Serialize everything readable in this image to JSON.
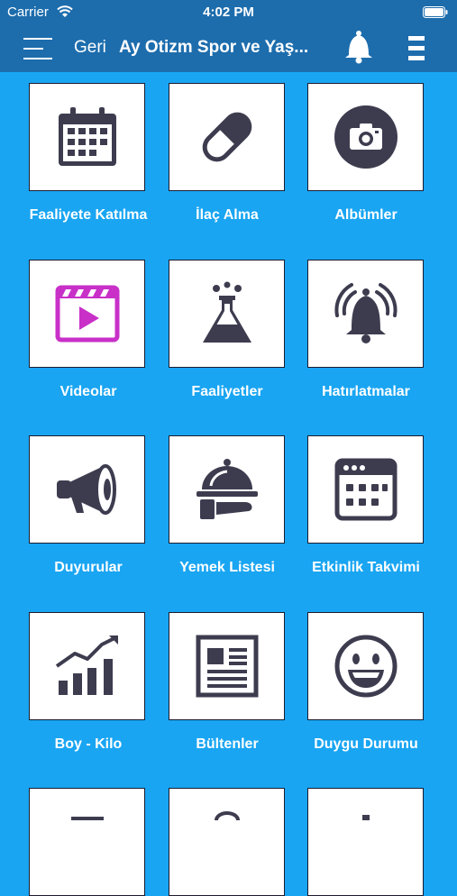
{
  "status": {
    "carrier": "Carrier",
    "time": "4:02 PM"
  },
  "header": {
    "back": "Geri",
    "title": "Ay Otizm Spor ve Yaş..."
  },
  "colors": {
    "accent": "#19a5f2",
    "navbar": "#1d6dad",
    "icon": "#3d3c4f",
    "video": "#c830c8"
  },
  "tiles": [
    {
      "label": "Faaliyete Katılma",
      "icon": "calendar-icon"
    },
    {
      "label": "İlaç Alma",
      "icon": "pill-icon"
    },
    {
      "label": "Albümler",
      "icon": "camera-icon"
    },
    {
      "label": "Videolar",
      "icon": "video-icon"
    },
    {
      "label": "Faaliyetler",
      "icon": "flask-icon"
    },
    {
      "label": "Hatırlatmalar",
      "icon": "bell-ringing-icon"
    },
    {
      "label": "Duyurular",
      "icon": "megaphone-icon"
    },
    {
      "label": "Yemek Listesi",
      "icon": "food-tray-icon"
    },
    {
      "label": "Etkinlik Takvimi",
      "icon": "event-calendar-icon"
    },
    {
      "label": "Boy - Kilo",
      "icon": "growth-chart-icon"
    },
    {
      "label": "Bültenler",
      "icon": "newsletter-icon"
    },
    {
      "label": "Duygu Durumu",
      "icon": "smiley-icon"
    }
  ]
}
